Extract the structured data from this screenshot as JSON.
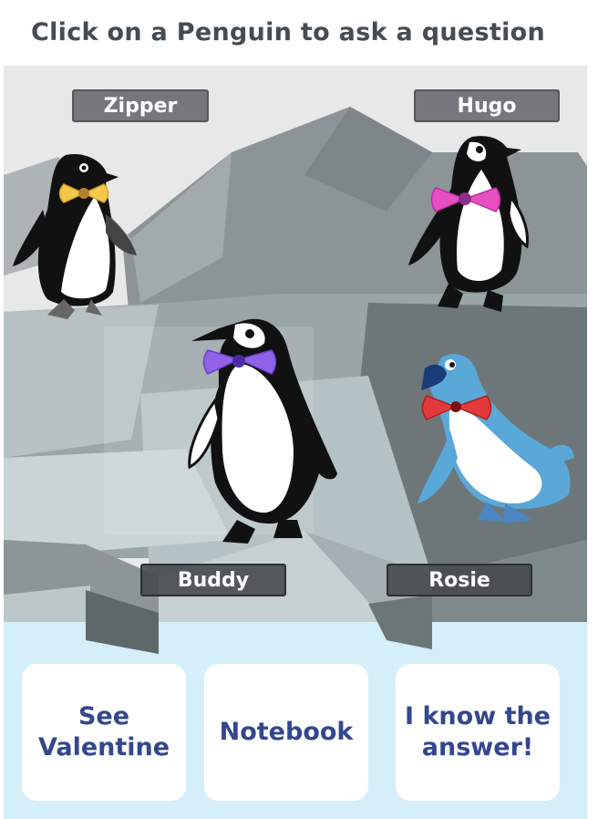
{
  "header": {
    "title": "Click on a Penguin to ask a question"
  },
  "penguins": [
    {
      "id": "zipper",
      "name": "Zipper",
      "bowtie_color": "#f4c84a"
    },
    {
      "id": "hugo",
      "name": "Hugo",
      "bowtie_color": "#e84fc0"
    },
    {
      "id": "buddy",
      "name": "Buddy",
      "bowtie_color": "#8f62e8"
    },
    {
      "id": "rosie",
      "name": "Rosie",
      "bowtie_color": "#e23a3a",
      "body_color": "#5aa8d8"
    }
  ],
  "buttons": {
    "see_valentine": "See\nValentine",
    "notebook": "Notebook",
    "know_answer": "I know the\nanswer!"
  },
  "colors": {
    "text_dark": "#444c54",
    "button_text": "#33478f",
    "sky": "#e8e8e8",
    "ice": "#d4eff9"
  }
}
